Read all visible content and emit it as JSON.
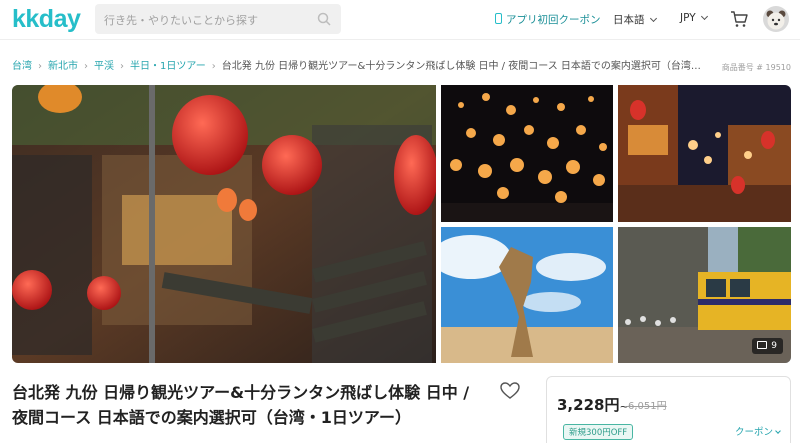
{
  "header": {
    "logo": "kkday",
    "search_placeholder": "行き先・やりたいことから探す",
    "app_coupon": "アプリ初回クーポン",
    "language": "日本語",
    "currency": "JPY"
  },
  "breadcrumb": {
    "items": [
      "台湾",
      "新北市",
      "平渓",
      "半日・1日ツアー"
    ],
    "current": "台北発 九份 日帰り観光ツアー&十分ランタン飛ばし体験 日中 / 夜間コース 日本語での案内選択可（台湾…"
  },
  "product_number": "商品番号 # 19510",
  "gallery": {
    "photo_count": "9",
    "images": [
      "jiufen-lantern-street",
      "sky-lanterns-night",
      "jiufen-teahouse-night",
      "queens-head-rock",
      "pingxi-train"
    ]
  },
  "product": {
    "title": "台北発 九份 日帰り観光ツアー&十分ランタン飛ばし体験 日中 / 夜間コース 日本語での案内選択可（台湾・1日ツアー）"
  },
  "pricing": {
    "price": "3,228円",
    "price_suffix": "~",
    "original_price": "6,051円",
    "badge": "新規300円OFF",
    "coupon_label": "クーポン"
  },
  "colors": {
    "brand": "#26bec9",
    "link": "#26a5ae",
    "badge": "#2e9c8a"
  }
}
